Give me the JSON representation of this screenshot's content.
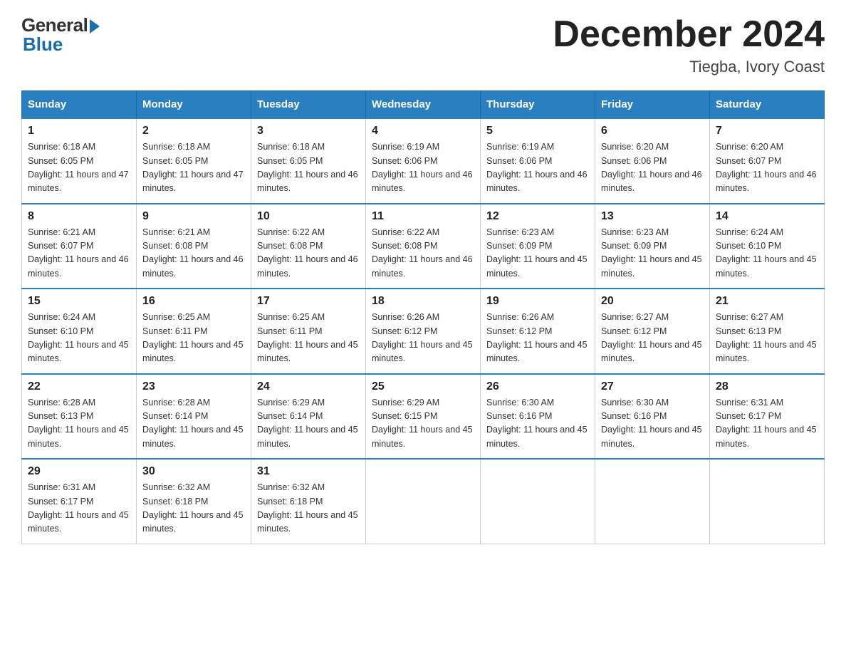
{
  "logo": {
    "general": "General",
    "blue": "Blue"
  },
  "title": {
    "month": "December 2024",
    "location": "Tiegba, Ivory Coast"
  },
  "headers": [
    "Sunday",
    "Monday",
    "Tuesday",
    "Wednesday",
    "Thursday",
    "Friday",
    "Saturday"
  ],
  "weeks": [
    [
      {
        "day": "1",
        "sunrise": "6:18 AM",
        "sunset": "6:05 PM",
        "daylight": "11 hours and 47 minutes."
      },
      {
        "day": "2",
        "sunrise": "6:18 AM",
        "sunset": "6:05 PM",
        "daylight": "11 hours and 47 minutes."
      },
      {
        "day": "3",
        "sunrise": "6:18 AM",
        "sunset": "6:05 PM",
        "daylight": "11 hours and 46 minutes."
      },
      {
        "day": "4",
        "sunrise": "6:19 AM",
        "sunset": "6:06 PM",
        "daylight": "11 hours and 46 minutes."
      },
      {
        "day": "5",
        "sunrise": "6:19 AM",
        "sunset": "6:06 PM",
        "daylight": "11 hours and 46 minutes."
      },
      {
        "day": "6",
        "sunrise": "6:20 AM",
        "sunset": "6:06 PM",
        "daylight": "11 hours and 46 minutes."
      },
      {
        "day": "7",
        "sunrise": "6:20 AM",
        "sunset": "6:07 PM",
        "daylight": "11 hours and 46 minutes."
      }
    ],
    [
      {
        "day": "8",
        "sunrise": "6:21 AM",
        "sunset": "6:07 PM",
        "daylight": "11 hours and 46 minutes."
      },
      {
        "day": "9",
        "sunrise": "6:21 AM",
        "sunset": "6:08 PM",
        "daylight": "11 hours and 46 minutes."
      },
      {
        "day": "10",
        "sunrise": "6:22 AM",
        "sunset": "6:08 PM",
        "daylight": "11 hours and 46 minutes."
      },
      {
        "day": "11",
        "sunrise": "6:22 AM",
        "sunset": "6:08 PM",
        "daylight": "11 hours and 46 minutes."
      },
      {
        "day": "12",
        "sunrise": "6:23 AM",
        "sunset": "6:09 PM",
        "daylight": "11 hours and 45 minutes."
      },
      {
        "day": "13",
        "sunrise": "6:23 AM",
        "sunset": "6:09 PM",
        "daylight": "11 hours and 45 minutes."
      },
      {
        "day": "14",
        "sunrise": "6:24 AM",
        "sunset": "6:10 PM",
        "daylight": "11 hours and 45 minutes."
      }
    ],
    [
      {
        "day": "15",
        "sunrise": "6:24 AM",
        "sunset": "6:10 PM",
        "daylight": "11 hours and 45 minutes."
      },
      {
        "day": "16",
        "sunrise": "6:25 AM",
        "sunset": "6:11 PM",
        "daylight": "11 hours and 45 minutes."
      },
      {
        "day": "17",
        "sunrise": "6:25 AM",
        "sunset": "6:11 PM",
        "daylight": "11 hours and 45 minutes."
      },
      {
        "day": "18",
        "sunrise": "6:26 AM",
        "sunset": "6:12 PM",
        "daylight": "11 hours and 45 minutes."
      },
      {
        "day": "19",
        "sunrise": "6:26 AM",
        "sunset": "6:12 PM",
        "daylight": "11 hours and 45 minutes."
      },
      {
        "day": "20",
        "sunrise": "6:27 AM",
        "sunset": "6:12 PM",
        "daylight": "11 hours and 45 minutes."
      },
      {
        "day": "21",
        "sunrise": "6:27 AM",
        "sunset": "6:13 PM",
        "daylight": "11 hours and 45 minutes."
      }
    ],
    [
      {
        "day": "22",
        "sunrise": "6:28 AM",
        "sunset": "6:13 PM",
        "daylight": "11 hours and 45 minutes."
      },
      {
        "day": "23",
        "sunrise": "6:28 AM",
        "sunset": "6:14 PM",
        "daylight": "11 hours and 45 minutes."
      },
      {
        "day": "24",
        "sunrise": "6:29 AM",
        "sunset": "6:14 PM",
        "daylight": "11 hours and 45 minutes."
      },
      {
        "day": "25",
        "sunrise": "6:29 AM",
        "sunset": "6:15 PM",
        "daylight": "11 hours and 45 minutes."
      },
      {
        "day": "26",
        "sunrise": "6:30 AM",
        "sunset": "6:16 PM",
        "daylight": "11 hours and 45 minutes."
      },
      {
        "day": "27",
        "sunrise": "6:30 AM",
        "sunset": "6:16 PM",
        "daylight": "11 hours and 45 minutes."
      },
      {
        "day": "28",
        "sunrise": "6:31 AM",
        "sunset": "6:17 PM",
        "daylight": "11 hours and 45 minutes."
      }
    ],
    [
      {
        "day": "29",
        "sunrise": "6:31 AM",
        "sunset": "6:17 PM",
        "daylight": "11 hours and 45 minutes."
      },
      {
        "day": "30",
        "sunrise": "6:32 AM",
        "sunset": "6:18 PM",
        "daylight": "11 hours and 45 minutes."
      },
      {
        "day": "31",
        "sunrise": "6:32 AM",
        "sunset": "6:18 PM",
        "daylight": "11 hours and 45 minutes."
      },
      null,
      null,
      null,
      null
    ]
  ],
  "labels": {
    "sunrise": "Sunrise:",
    "sunset": "Sunset:",
    "daylight": "Daylight:"
  }
}
